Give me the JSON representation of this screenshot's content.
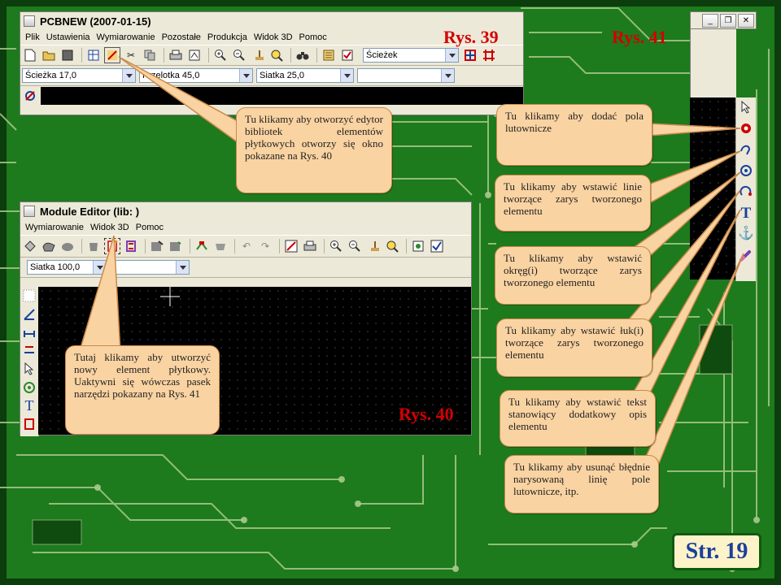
{
  "colors": {
    "pcb_green": "#1d7a1d",
    "trace": "#a8c98a",
    "callout_fill": "#fad3a2",
    "callout_border": "#c98a4a",
    "red_label": "#d40000",
    "canvas": "#000000"
  },
  "pcbnew": {
    "title": "PCBNEW (2007-01-15)",
    "menu": [
      "Plik",
      "Ustawienia",
      "Wymiarowanie",
      "Pozostałe",
      "Produkcja",
      "Widok 3D",
      "Pomoc"
    ],
    "layer_select": "Ścieżek",
    "track_select": "Ścieżka 17,0",
    "via_select": "Przelotka 45,0",
    "grid_select": "Siatka 25,0",
    "extra_select": ""
  },
  "module_editor": {
    "title": "Module Editor (lib: )",
    "menu": [
      "Wymiarowanie",
      "Widok 3D",
      "Pomoc"
    ],
    "grid_select": "Siatka 100,0",
    "extra_select": ""
  },
  "labels": {
    "rys39": "Rys. 39",
    "rys40": "Rys. 40",
    "rys41": "Rys. 41",
    "page": "Str. 19"
  },
  "callouts": {
    "open_library_editor": "Tu klikamy aby otworzyć edytor bibliotek elementów płytkowych otworzy się okno pokazane na Rys. 40",
    "new_module": "Tutaj klikamy aby utworzyć nowy element płytkowy. Uaktywni się wówczas pasek narzędzi pokazany na Rys. 41",
    "add_pad": "Tu klikamy aby dodać pola lutownicze",
    "add_line": "Tu klikamy aby wstawić linie tworzące zarys tworzonego elementu",
    "add_circle": "Tu klikamy aby wstawić okręg(i) tworzące zarys tworzonego elementu",
    "add_arc": "Tu klikamy aby wstawić łuk(i) tworzące zarys tworzonego elementu",
    "add_text": "Tu klikamy aby wstawić tekst stanowiący dodatkowy opis elementu",
    "delete": "Tu klikamy aby usunąć błędnie narysowaną linię pole lutownicze, itp."
  },
  "icons": {
    "pad": "pad-icon",
    "line": "line-icon",
    "circle": "circle-icon",
    "arc": "arc-icon",
    "text": "text-icon",
    "anchor": "anchor-icon",
    "delete": "delete-icon",
    "cursor": "cursor-icon"
  }
}
